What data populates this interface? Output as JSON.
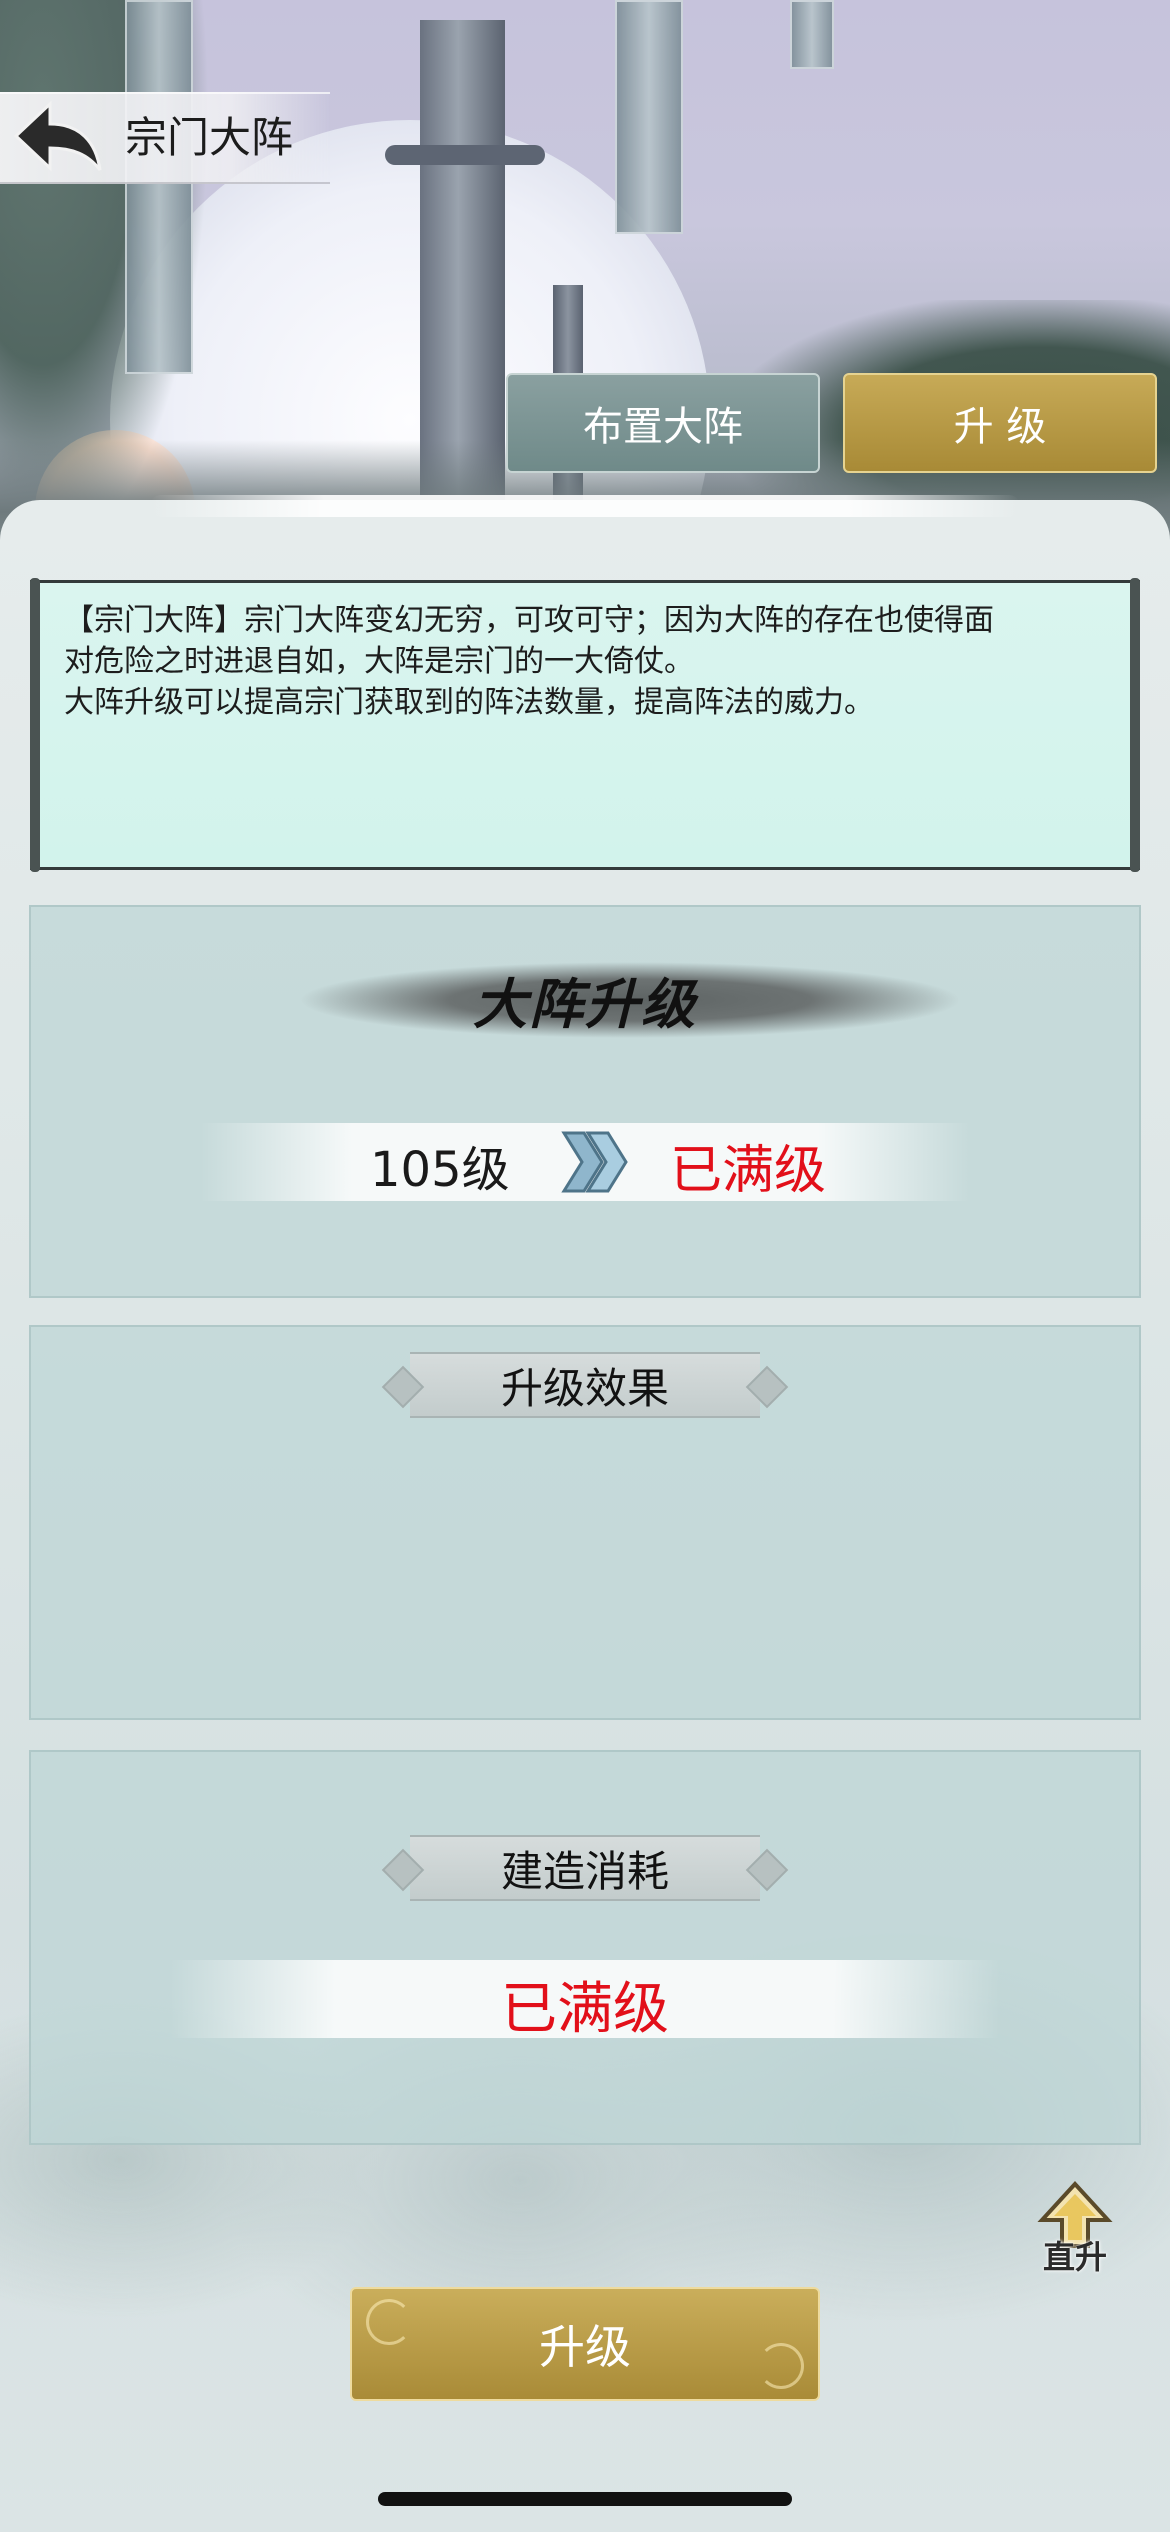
{
  "header": {
    "title": "宗门大阵"
  },
  "tabs": [
    {
      "label": "布置大阵",
      "active": false
    },
    {
      "label": "升 级",
      "active": true
    }
  ],
  "description": {
    "line1": "【宗门大阵】宗门大阵变幻无穷，可攻可守；因为大阵的存在也使得面",
    "line2": "对危险之时进退自如，大阵是宗门的一大倚仗。",
    "line3": "大阵升级可以提高宗门获取到的阵法数量，提高阵法的威力。"
  },
  "upgrade_section": {
    "title": "大阵升级",
    "current_level": "105级",
    "next_level": "已满级"
  },
  "effect_section": {
    "label": "升级效果"
  },
  "cost_section": {
    "label": "建造消耗",
    "value": "已满级"
  },
  "direct_up": {
    "label": "直升"
  },
  "bottom_button": {
    "label": "升级"
  },
  "colors": {
    "gold_button": "#b89a47",
    "teal_tab": "#7d9594",
    "max_level_red": "#e2101a",
    "scroll_bg": "#d5f4ed"
  }
}
